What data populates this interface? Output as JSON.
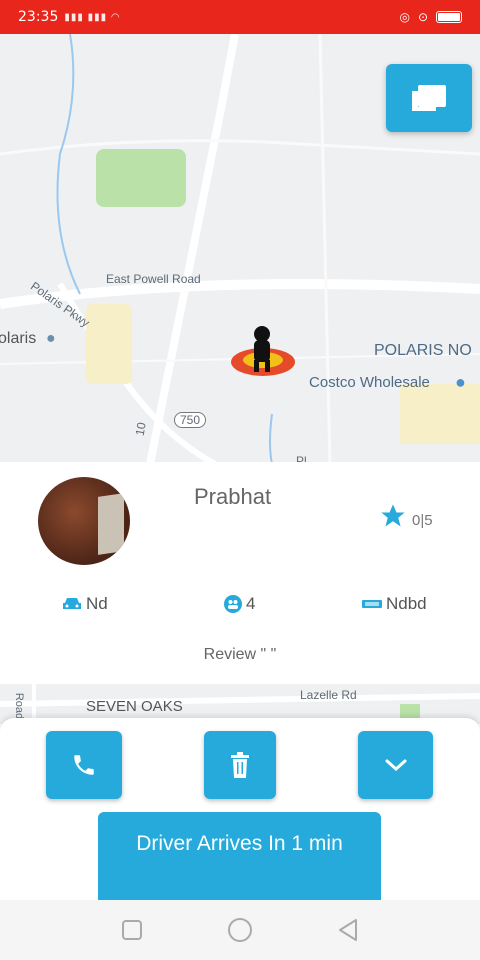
{
  "status_bar": {
    "time": "23:35",
    "signal_text": "···"
  },
  "map": {
    "labels": [
      "East Powell Road",
      "Polaris Pkwy",
      "olaris",
      "POLARIS NO",
      "Costco Wholesale",
      "750",
      "10",
      "Pl"
    ],
    "bottom_labels": [
      "Road",
      "SEVEN OAKS",
      "Lazelle Rd"
    ]
  },
  "driver": {
    "name": "Prabhat",
    "rating": "0|5"
  },
  "ride_info": {
    "car": "Nd",
    "seats": "4",
    "plate": "Ndbd"
  },
  "review": "Review \" \"",
  "arrival": "Driver Arrives In 1 min",
  "colors": {
    "accent": "#25aadb",
    "status_bar": "#e8261c",
    "map_bg": "#eef0f2"
  },
  "icons": [
    "chat-icon",
    "phone-icon",
    "trash-icon",
    "chevron-down-icon",
    "star-icon",
    "car-icon",
    "people-icon",
    "plate-icon"
  ]
}
